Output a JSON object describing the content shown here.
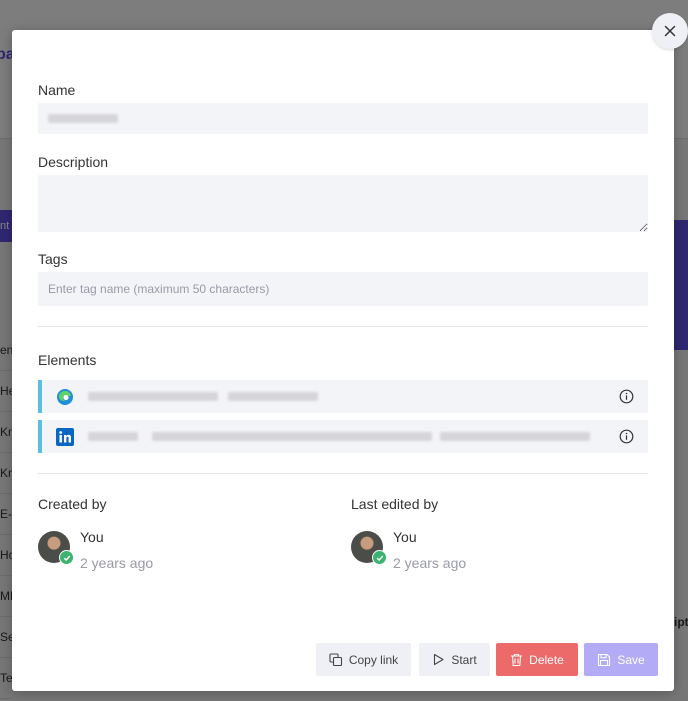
{
  "background": {
    "brand_fragment": "pa",
    "left_tab_fragment": "nt",
    "left_rows": [
      "en",
      "He",
      "Kn",
      "Kn",
      "E-p",
      "Ho",
      "MF",
      "Se",
      "Tea"
    ],
    "right_fragment": "ipt"
  },
  "modal": {
    "close_icon": "close-icon",
    "name": {
      "label": "Name",
      "value": ""
    },
    "description": {
      "label": "Description",
      "value": ""
    },
    "tags": {
      "label": "Tags",
      "placeholder": "Enter tag name (maximum 50 characters)"
    },
    "elements": {
      "label": "Elements",
      "items": [
        {
          "logo": "edge-logo",
          "icon": "info-icon"
        },
        {
          "logo": "linkedin-logo",
          "icon": "info-icon"
        }
      ]
    },
    "created_by": {
      "label": "Created by",
      "name": "You",
      "time": "2 years ago"
    },
    "last_edited_by": {
      "label": "Last edited by",
      "name": "You",
      "time": "2 years ago"
    },
    "actions": {
      "copy_link": "Copy link",
      "start": "Start",
      "delete": "Delete",
      "save": "Save"
    },
    "colors": {
      "accent": "#5b4ed8",
      "delete": "#ec6a6a",
      "save": "#b3abf6",
      "element_bar": "#5bc0de"
    }
  }
}
